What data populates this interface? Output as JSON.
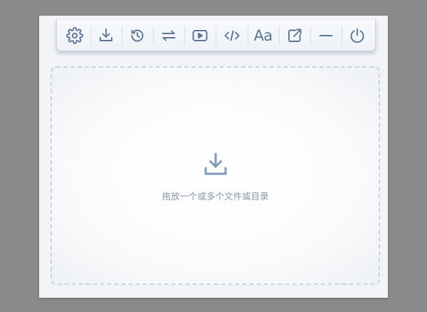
{
  "toolbar": {
    "buttons": [
      {
        "icon": "gear-icon"
      },
      {
        "icon": "download-icon"
      },
      {
        "icon": "history-icon"
      },
      {
        "icon": "swap-icon"
      },
      {
        "icon": "play-icon"
      },
      {
        "icon": "code-icon"
      },
      {
        "icon": "font-icon",
        "label": "Aa"
      },
      {
        "icon": "share-icon"
      },
      {
        "icon": "minimize-icon"
      },
      {
        "icon": "power-icon"
      }
    ]
  },
  "dropzone": {
    "icon": "download-icon",
    "text": "拖放一个或多个文件或目录"
  },
  "colors": {
    "icon": "#5a7596",
    "dropzone_icon": "#7e98b8",
    "dropzone_text": "#8796aa",
    "backdrop": "#8a8a8a"
  }
}
